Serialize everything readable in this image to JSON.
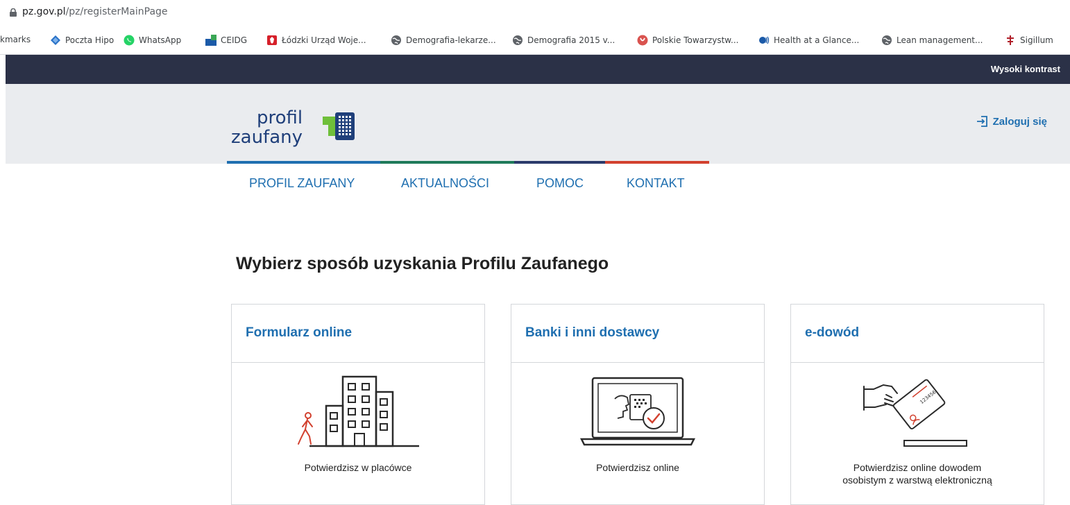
{
  "browser": {
    "url_host": "pz.gov.pl",
    "url_path": "/pz/registerMainPage",
    "bookmarks": [
      {
        "label": "kmarks",
        "icon": "bookmarks-folder-icon"
      },
      {
        "label": "Poczta Hipo",
        "icon": "mail-icon"
      },
      {
        "label": "WhatsApp",
        "icon": "whatsapp-icon"
      },
      {
        "label": "CEIDG",
        "icon": "ceidg-icon"
      },
      {
        "label": "Łódzki Urząd Woje...",
        "icon": "emblem-icon"
      },
      {
        "label": "Demografia-lekarze...",
        "icon": "globe-icon"
      },
      {
        "label": "Demografia 2015 v...",
        "icon": "globe-icon"
      },
      {
        "label": "Polskie Towarzystw...",
        "icon": "society-icon"
      },
      {
        "label": "Health at a Glance...",
        "icon": "oecd-icon"
      },
      {
        "label": "Lean management...",
        "icon": "globe-icon"
      },
      {
        "label": "Sigillum",
        "icon": "sigillum-icon"
      }
    ]
  },
  "site": {
    "contrast_label": "Wysoki kontrast",
    "logo_word1": "profil",
    "logo_word2": "zaufany",
    "login_label": "Zaloguj się",
    "nav": [
      "PROFIL ZAUFANY",
      "AKTUALNOŚCI",
      "POMOC",
      "KONTAKT"
    ],
    "nav_colors": [
      "#1f6fb0",
      "#1f7a5a",
      "#2b3a6b",
      "#d2412f"
    ],
    "title": "Wybierz sposób uzyskania Profilu Zaufanego",
    "cards": [
      {
        "title": "Formularz online",
        "desc_line1": "Potwierdzisz w placówce",
        "desc_line2": ""
      },
      {
        "title": "Banki i inni dostawcy",
        "desc_line1": "Potwierdzisz online",
        "desc_line2": ""
      },
      {
        "title": "e-dowód",
        "desc_line1": "Potwierdzisz online dowodem",
        "desc_line2": "osobistym z warstwą elektroniczną"
      }
    ],
    "id_card_number": "123456",
    "accent_red": "#d2412f",
    "brand_blue": "#1f6fb0"
  }
}
